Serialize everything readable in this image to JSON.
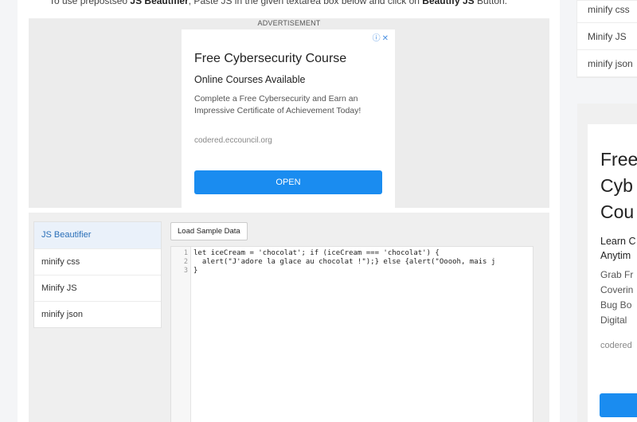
{
  "intro": {
    "prefix": "To use prepostseo ",
    "tool_name": "JS Beautifier",
    "middle": ", Paste JS in the given textarea box below and click on ",
    "button_name": "Beautify JS",
    "suffix": " Button."
  },
  "ad": {
    "label": "ADVERTISEMENT",
    "choices": "ⓘ✕",
    "title": "Free Cybersecurity Course",
    "subtitle": "Online Courses Available",
    "body": "Complete a Free Cybersecurity and Earn an Impressive Certificate of Achievement Today!",
    "domain": "codered.eccouncil.org",
    "open_label": "OPEN"
  },
  "tool_nav": {
    "items": [
      {
        "label": "JS Beautifier",
        "active": true
      },
      {
        "label": "minify css"
      },
      {
        "label": "Minify JS"
      },
      {
        "label": "minify json"
      }
    ]
  },
  "toolbar": {
    "load_sample_label": "Load Sample Data"
  },
  "editor": {
    "line_numbers": [
      "1",
      "2",
      "3"
    ],
    "lines": [
      "let iceCream = 'chocolat'; if (iceCream === 'chocolat') {",
      "  alert(\"J'adore la glace au chocolat !\");} else {alert(\"Ooooh, mais j",
      "}"
    ]
  },
  "right_sidebar": {
    "items": [
      "minify css",
      "Minify JS",
      "minify json"
    ]
  },
  "right_ad": {
    "title": "Free\nCyb\nCou",
    "subtitle": "Learn C\nAnytim",
    "body": "Grab Fr\nCoverin\nBug Bo\nDigital",
    "domain": "codered"
  },
  "colors": {
    "accent": "#1a8cf0",
    "active_nav_bg": "#eaf1fa",
    "active_nav_text": "#2a6fb8"
  }
}
